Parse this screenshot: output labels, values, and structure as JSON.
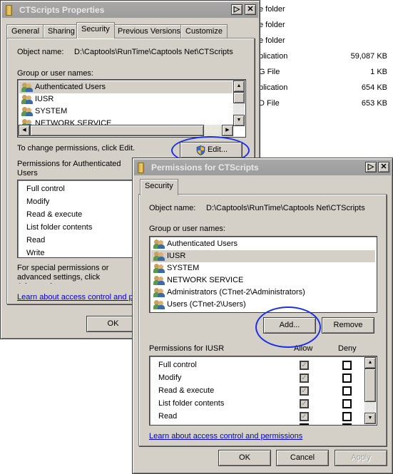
{
  "background_explorer": {
    "rows": [
      {
        "type": "e folder",
        "size": ""
      },
      {
        "type": "e folder",
        "size": ""
      },
      {
        "type": "e folder",
        "size": ""
      },
      {
        "type": "plication",
        "size": "59,087 KB"
      },
      {
        "type": "G File",
        "size": "1 KB"
      },
      {
        "type": "plication",
        "size": "654 KB"
      },
      {
        "type": "D File",
        "size": "653 KB"
      }
    ]
  },
  "properties_window": {
    "title": "CTScripts Properties",
    "tabs": [
      "General",
      "Sharing",
      "Security",
      "Previous Versions",
      "Customize"
    ],
    "active_tab": "Security",
    "object_name_label": "Object name:",
    "object_name_value": "D:\\Captools\\RunTime\\Captools Net\\CTScripts",
    "group_label": "Group or user names:",
    "users": [
      "Authenticated Users",
      "IUSR",
      "SYSTEM",
      "NETWORK SERVICE"
    ],
    "change_hint": "To change permissions, click Edit.",
    "edit_button": "Edit...",
    "permissions_label": "Permissions for Authenticated Users",
    "permissions": [
      "Full control",
      "Modify",
      "Read & execute",
      "List folder contents",
      "Read",
      "Write"
    ],
    "special_hint": "For special permissions or advanced settings, click Advanced.",
    "learn_link": "Learn about access control and permissions",
    "ok_button": "OK"
  },
  "permissions_window": {
    "title": "Permissions for CTScripts",
    "tab": "Security",
    "object_name_label": "Object name:",
    "object_name_value": "D:\\Captools\\RunTime\\Captools Net\\CTScripts",
    "group_label": "Group or user names:",
    "users": [
      "Authenticated Users",
      "IUSR",
      "SYSTEM",
      "NETWORK SERVICE",
      "Administrators (CTnet-2\\Administrators)",
      "Users (CTnet-2\\Users)"
    ],
    "selected_user": "IUSR",
    "add_button": "Add...",
    "remove_button": "Remove",
    "permissions_label": "Permissions for IUSR",
    "allow_header": "Allow",
    "deny_header": "Deny",
    "permissions": [
      {
        "name": "Full control",
        "allow": true,
        "deny": false
      },
      {
        "name": "Modify",
        "allow": true,
        "deny": false
      },
      {
        "name": "Read & execute",
        "allow": true,
        "deny": false
      },
      {
        "name": "List folder contents",
        "allow": true,
        "deny": false
      },
      {
        "name": "Read",
        "allow": true,
        "deny": false
      }
    ],
    "learn_link": "Learn about access control and permissions",
    "ok_button": "OK",
    "cancel_button": "Cancel",
    "apply_button": "Apply"
  },
  "annotation_color": "#1a2ee8"
}
